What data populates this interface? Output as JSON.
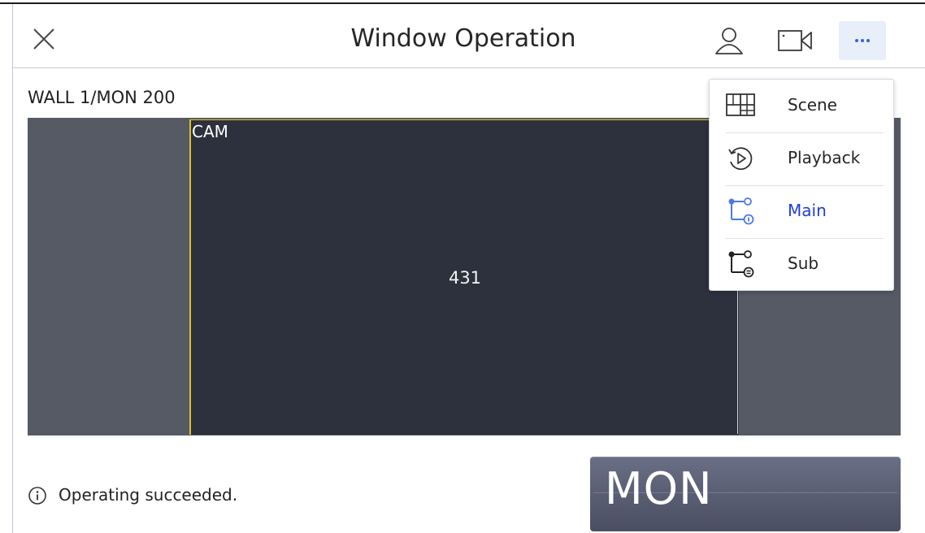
{
  "header": {
    "title": "Window Operation"
  },
  "breadcrumb": "WALL 1/MON 200",
  "tile": {
    "label": "CAM",
    "number": "431"
  },
  "menu": {
    "items": [
      {
        "label": "Scene",
        "icon": "scene-layout-icon"
      },
      {
        "label": "Playback",
        "icon": "playback-icon"
      },
      {
        "label": "Main",
        "icon": "main-stream-icon",
        "active": true
      },
      {
        "label": "Sub",
        "icon": "sub-stream-icon"
      }
    ]
  },
  "status": {
    "message": "Operating succeeded."
  },
  "mon_button": {
    "label": "MON"
  },
  "colors": {
    "accent": "#3563d8",
    "active_menu": "#1f3ddb",
    "selected_border": "#e1c21d",
    "wall_bg": "#555a64",
    "tile_bg": "#2d303d"
  }
}
